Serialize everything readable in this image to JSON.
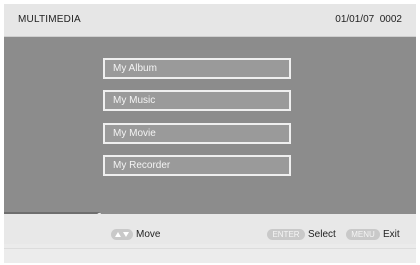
{
  "header": {
    "title": "MULTIMEDIA",
    "status": "01/01/07  0002"
  },
  "menu": {
    "items": [
      {
        "label": "My Album"
      },
      {
        "label": "My Music"
      },
      {
        "label": "My Movie"
      },
      {
        "label": "My Recorder"
      }
    ]
  },
  "footer": {
    "nav_label": "Move",
    "enter_key": "ENTER",
    "enter_label": "Select",
    "menu_key": "MENU",
    "menu_label": "Exit"
  },
  "colors": {
    "panel": "#8c8c8c",
    "item_border": "#efefef",
    "key_badge": "#c9c9c9"
  },
  "icons": {
    "nav": "up-down-arrows-icon"
  }
}
